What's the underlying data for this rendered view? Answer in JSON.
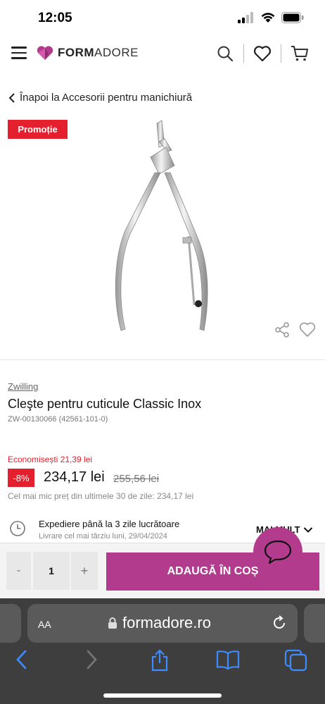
{
  "status": {
    "time": "12:05"
  },
  "header": {
    "logo_bold": "FORM",
    "logo_light": "ADORE"
  },
  "back": {
    "label": "Înapoi la Accesorii pentru manichiură"
  },
  "promo": {
    "label": "Promoție"
  },
  "product": {
    "brand": "Zwilling",
    "title": "Cleşte pentru cuticule Classic Inox",
    "sku": "ZW-00130066 (42561-101-0)",
    "savings": "Economisești 21,39 lei",
    "discount": "-8%",
    "price": "234,17 lei",
    "old_price": "255,56 lei",
    "lowest_price_note": "Cel mai mic preț din ultimele 30 de zile: 234,17 lei"
  },
  "delivery": {
    "title": "Expediere până la 3 zile lucrătoare",
    "date": "Livrare cel mai târziu luni, 29/04/2024",
    "more": "MAI MULT"
  },
  "cart": {
    "minus": "-",
    "quantity": "1",
    "plus": "+",
    "add_label": "ADAUGĂ ÎN COȘ"
  },
  "browser": {
    "aa": "AA",
    "url": "formadore.ro"
  },
  "colors": {
    "accent": "#b23b8e",
    "promo_red": "#e5202e"
  }
}
